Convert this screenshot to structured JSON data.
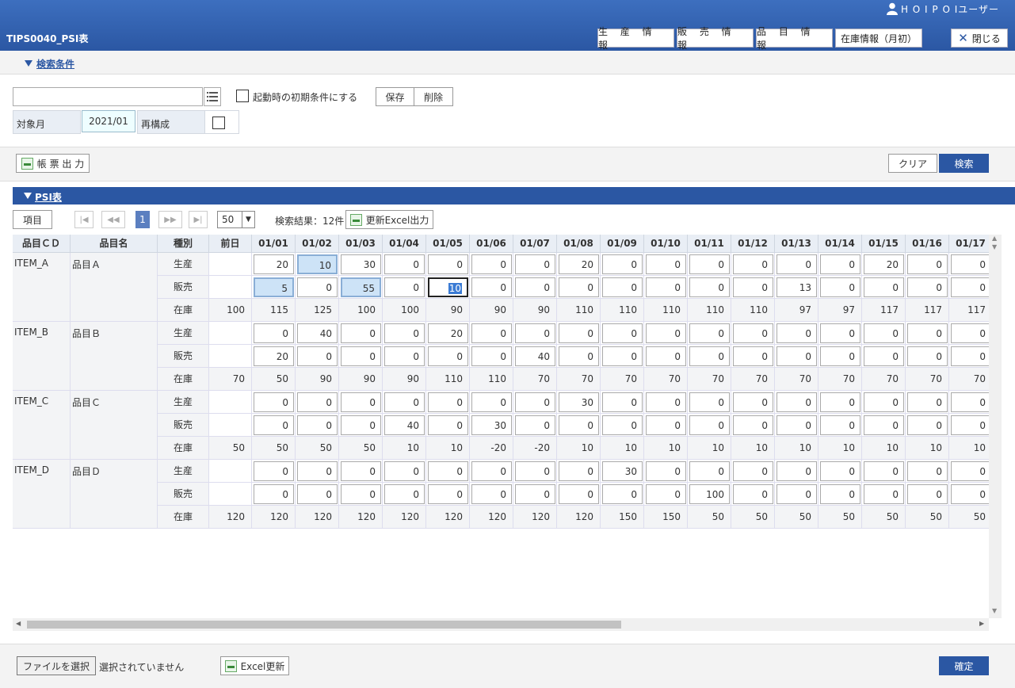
{
  "header": {
    "user_name": "H O I P O Iユーザー",
    "screen_title": "TIPS0040_PSI表",
    "buttons": {
      "production": "生 産 情 報",
      "sales": "販 売 情 報",
      "items": "品 目 情 報",
      "inventory": "在庫情報（月初）",
      "close": "閉じる"
    }
  },
  "search_conditions": {
    "section_title": "検索条件",
    "condition_input_value": "",
    "default_checkbox_label": "起動時の初期条件にする",
    "save_label": "保存",
    "delete_label": "削除",
    "target_month_label": "対象月",
    "target_month_value": "2021/01",
    "rebuild_label": "再構成"
  },
  "actions": {
    "report_output_label": "帳 票 出 力",
    "clear_label": "クリア",
    "search_label": "検索"
  },
  "psi": {
    "section_title": "PSI表",
    "item_button_label": "項目",
    "pager": {
      "current_page": "1",
      "page_size": "50",
      "first": "|◀",
      "prev": "◀◀",
      "next": "▶▶",
      "last": "▶|"
    },
    "result_text": "検索結果：12件",
    "excel_output_label": "更新Excel出力",
    "columns": {
      "code": "品目ＣＤ",
      "name": "品目名",
      "kind": "種別",
      "previous": "前日",
      "dates": [
        "01/01",
        "01/02",
        "01/03",
        "01/04",
        "01/05",
        "01/06",
        "01/07",
        "01/08",
        "01/09",
        "01/10",
        "01/11",
        "01/12",
        "01/13",
        "01/14",
        "01/15",
        "01/16",
        "01/17"
      ]
    },
    "kind_labels": {
      "production": "生産",
      "sales": "販売",
      "inventory": "在庫"
    },
    "items": [
      {
        "code": "ITEM_A",
        "name": "品目Ａ",
        "previous": "100",
        "production": [
          "20",
          "10",
          "30",
          "0",
          "0",
          "0",
          "0",
          "20",
          "0",
          "0",
          "0",
          "0",
          "0",
          "0",
          "20",
          "0",
          "0"
        ],
        "sales": [
          "5",
          "0",
          "55",
          "0",
          "10",
          "0",
          "0",
          "0",
          "0",
          "0",
          "0",
          "0",
          "13",
          "0",
          "0",
          "0",
          "0"
        ],
        "inventory": [
          "115",
          "125",
          "100",
          "100",
          "90",
          "90",
          "90",
          "110",
          "110",
          "110",
          "110",
          "110",
          "97",
          "97",
          "117",
          "117",
          "117"
        ]
      },
      {
        "code": "ITEM_B",
        "name": "品目Ｂ",
        "previous": "70",
        "production": [
          "0",
          "40",
          "0",
          "0",
          "20",
          "0",
          "0",
          "0",
          "0",
          "0",
          "0",
          "0",
          "0",
          "0",
          "0",
          "0",
          "0"
        ],
        "sales": [
          "20",
          "0",
          "0",
          "0",
          "0",
          "0",
          "40",
          "0",
          "0",
          "0",
          "0",
          "0",
          "0",
          "0",
          "0",
          "0",
          "0"
        ],
        "inventory": [
          "50",
          "90",
          "90",
          "90",
          "110",
          "110",
          "70",
          "70",
          "70",
          "70",
          "70",
          "70",
          "70",
          "70",
          "70",
          "70",
          "70"
        ]
      },
      {
        "code": "ITEM_C",
        "name": "品目Ｃ",
        "previous": "50",
        "production": [
          "0",
          "0",
          "0",
          "0",
          "0",
          "0",
          "0",
          "30",
          "0",
          "0",
          "0",
          "0",
          "0",
          "0",
          "0",
          "0",
          "0"
        ],
        "sales": [
          "0",
          "0",
          "0",
          "40",
          "0",
          "30",
          "0",
          "0",
          "0",
          "0",
          "0",
          "0",
          "0",
          "0",
          "0",
          "0",
          "0"
        ],
        "inventory": [
          "50",
          "50",
          "50",
          "10",
          "10",
          "-20",
          "-20",
          "10",
          "10",
          "10",
          "10",
          "10",
          "10",
          "10",
          "10",
          "10",
          "10"
        ]
      },
      {
        "code": "ITEM_D",
        "name": "品目Ｄ",
        "previous": "120",
        "production": [
          "0",
          "0",
          "0",
          "0",
          "0",
          "0",
          "0",
          "0",
          "30",
          "0",
          "0",
          "0",
          "0",
          "0",
          "0",
          "0",
          "0"
        ],
        "sales": [
          "0",
          "0",
          "0",
          "0",
          "0",
          "0",
          "0",
          "0",
          "0",
          "0",
          "100",
          "0",
          "0",
          "0",
          "0",
          "0",
          "0"
        ],
        "inventory": [
          "120",
          "120",
          "120",
          "120",
          "120",
          "120",
          "120",
          "120",
          "150",
          "150",
          "50",
          "50",
          "50",
          "50",
          "50",
          "50",
          "50"
        ]
      }
    ]
  },
  "footer": {
    "file_select_label": "ファイルを選択",
    "file_status": "選択されていません",
    "excel_update_label": "Excel更新",
    "confirm_label": "確定"
  }
}
